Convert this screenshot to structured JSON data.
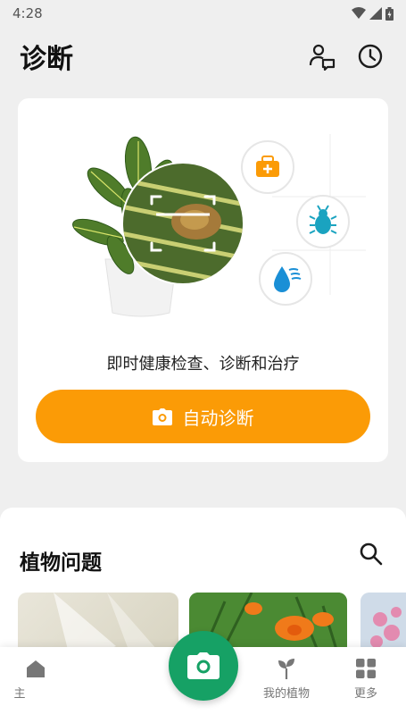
{
  "status_bar": {
    "time": "4:28"
  },
  "header": {
    "title": "诊断"
  },
  "card": {
    "tagline": "即时健康检查、诊断和治疗",
    "button_label": "自动诊断"
  },
  "section": {
    "title": "植物问题"
  },
  "nav": {
    "home_label": "主",
    "my_plants_label": "我的植物",
    "more_label": "更多"
  },
  "colors": {
    "accent": "#fb9b06",
    "brand_green": "#16a165"
  },
  "icons": [
    "wifi-icon",
    "signal-icon",
    "battery-icon",
    "expert-chat-icon",
    "history-clock-icon",
    "first-aid-icon",
    "bug-icon",
    "water-drop-icon",
    "camera-icon",
    "search-icon",
    "home-icon",
    "sprout-icon",
    "grid-icon"
  ]
}
